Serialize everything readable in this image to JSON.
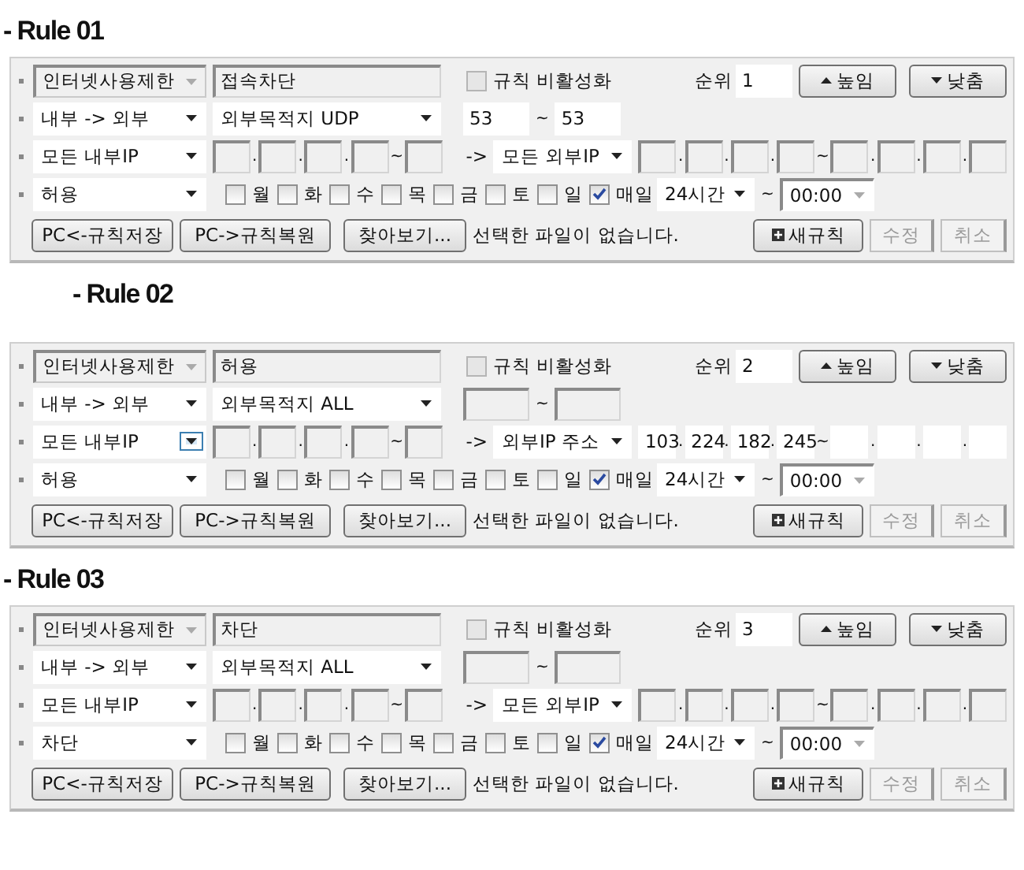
{
  "rules": [
    {
      "heading": "- Rule 01",
      "category": {
        "value": "인터넷사용제한",
        "disabled": true
      },
      "name": {
        "value": "접속차단",
        "disabled": true
      },
      "disable_rule": {
        "label": "규칙 비활성화",
        "checked": false,
        "disabled": true
      },
      "priority": {
        "label": "순위",
        "value": "1"
      },
      "raise_button": "높임",
      "lower_button": "낮춤",
      "direction": "내부 -> 외부",
      "destination": "외부목적지 UDP",
      "ports": [
        {
          "kind": "field",
          "value": "53",
          "disabled": false
        },
        {
          "kind": "sep",
          "text": "~"
        },
        {
          "kind": "field",
          "value": "53",
          "disabled": false
        }
      ],
      "source": {
        "value": "모든 내부IP",
        "focused": false
      },
      "source_ip": [
        {
          "kind": "field",
          "disabled": true
        },
        {
          "kind": "sep",
          "text": "."
        },
        {
          "kind": "field",
          "disabled": true
        },
        {
          "kind": "sep",
          "text": "."
        },
        {
          "kind": "field",
          "disabled": true
        },
        {
          "kind": "sep",
          "text": "."
        },
        {
          "kind": "field",
          "disabled": true
        },
        {
          "kind": "sep",
          "text": "~"
        },
        {
          "kind": "field",
          "disabled": true
        }
      ],
      "arrow": "->",
      "target": "모든 외부IP",
      "target_ip": [
        {
          "kind": "field",
          "disabled": true
        },
        {
          "kind": "sep",
          "text": "."
        },
        {
          "kind": "field",
          "disabled": true
        },
        {
          "kind": "sep",
          "text": "."
        },
        {
          "kind": "field",
          "disabled": true
        },
        {
          "kind": "sep",
          "text": "."
        },
        {
          "kind": "field",
          "disabled": true
        },
        {
          "kind": "sep",
          "text": "~"
        },
        {
          "kind": "field",
          "disabled": true
        },
        {
          "kind": "sep",
          "text": "."
        },
        {
          "kind": "field",
          "disabled": true
        },
        {
          "kind": "sep",
          "text": "."
        },
        {
          "kind": "field",
          "disabled": true
        },
        {
          "kind": "sep",
          "text": "."
        },
        {
          "kind": "field",
          "disabled": true
        }
      ],
      "action": "허용",
      "days": [
        {
          "label": "월",
          "checked": false
        },
        {
          "label": "화",
          "checked": false
        },
        {
          "label": "수",
          "checked": false
        },
        {
          "label": "목",
          "checked": false
        },
        {
          "label": "금",
          "checked": false
        },
        {
          "label": "토",
          "checked": false
        },
        {
          "label": "일",
          "checked": false
        }
      ],
      "daily": {
        "label": "매일",
        "checked": true
      },
      "duration": "24시간",
      "until_sep": "~",
      "until": {
        "value": "00:00",
        "disabled": true
      },
      "save_button": "PC<-규칙저장",
      "restore_button": "PC->규칙복원",
      "browse_button": "찾아보기...",
      "file_status": "선택한 파일이 없습니다.",
      "new_button": "새규칙",
      "edit_button": {
        "label": "수정",
        "disabled": true
      },
      "cancel_button": {
        "label": "취소",
        "disabled": true
      }
    },
    {
      "heading": "- Rule 02",
      "category": {
        "value": "인터넷사용제한",
        "disabled": true
      },
      "name": {
        "value": "허용",
        "disabled": true
      },
      "disable_rule": {
        "label": "규칙 비활성화",
        "checked": false,
        "disabled": true
      },
      "priority": {
        "label": "순위",
        "value": "2"
      },
      "raise_button": "높임",
      "lower_button": "낮춤",
      "direction": "내부 -> 외부",
      "destination": "외부목적지 ALL",
      "ports": [
        {
          "kind": "field",
          "disabled": true
        },
        {
          "kind": "sep",
          "text": "~"
        },
        {
          "kind": "field",
          "disabled": true
        }
      ],
      "source": {
        "value": "모든 내부IP",
        "focused": true
      },
      "source_ip": [
        {
          "kind": "field",
          "disabled": true
        },
        {
          "kind": "sep",
          "text": "."
        },
        {
          "kind": "field",
          "disabled": true
        },
        {
          "kind": "sep",
          "text": "."
        },
        {
          "kind": "field",
          "disabled": true
        },
        {
          "kind": "sep",
          "text": "."
        },
        {
          "kind": "field",
          "disabled": true
        },
        {
          "kind": "sep",
          "text": "~"
        },
        {
          "kind": "field",
          "disabled": true
        }
      ],
      "arrow": "->",
      "target": "외부IP 주소",
      "target_ip": [
        {
          "kind": "field",
          "value": "103",
          "disabled": false
        },
        {
          "kind": "sep",
          "text": "."
        },
        {
          "kind": "field",
          "value": "224",
          "disabled": false
        },
        {
          "kind": "sep",
          "text": "."
        },
        {
          "kind": "field",
          "value": "182",
          "disabled": false
        },
        {
          "kind": "sep",
          "text": "."
        },
        {
          "kind": "field",
          "value": "245",
          "disabled": false
        },
        {
          "kind": "sep",
          "text": "~"
        },
        {
          "kind": "field",
          "disabled": false
        },
        {
          "kind": "sep",
          "text": "."
        },
        {
          "kind": "field",
          "disabled": false
        },
        {
          "kind": "sep",
          "text": "."
        },
        {
          "kind": "field",
          "disabled": false
        },
        {
          "kind": "sep",
          "text": "."
        },
        {
          "kind": "field",
          "disabled": false
        }
      ],
      "action": "허용",
      "days": [
        {
          "label": "월",
          "checked": false
        },
        {
          "label": "화",
          "checked": false
        },
        {
          "label": "수",
          "checked": false
        },
        {
          "label": "목",
          "checked": false
        },
        {
          "label": "금",
          "checked": false
        },
        {
          "label": "토",
          "checked": false
        },
        {
          "label": "일",
          "checked": false
        }
      ],
      "daily": {
        "label": "매일",
        "checked": true
      },
      "duration": "24시간",
      "until_sep": "~",
      "until": {
        "value": "00:00",
        "disabled": true
      },
      "save_button": "PC<-규칙저장",
      "restore_button": "PC->규칙복원",
      "browse_button": "찾아보기...",
      "file_status": "선택한 파일이 없습니다.",
      "new_button": "새규칙",
      "edit_button": {
        "label": "수정",
        "disabled": true
      },
      "cancel_button": {
        "label": "취소",
        "disabled": true
      }
    },
    {
      "heading": "- Rule 03",
      "category": {
        "value": "인터넷사용제한",
        "disabled": true
      },
      "name": {
        "value": "차단",
        "disabled": true
      },
      "disable_rule": {
        "label": "규칙 비활성화",
        "checked": false,
        "disabled": true
      },
      "priority": {
        "label": "순위",
        "value": "3"
      },
      "raise_button": "높임",
      "lower_button": "낮춤",
      "direction": "내부 -> 외부",
      "destination": "외부목적지 ALL",
      "ports": [
        {
          "kind": "field",
          "disabled": true
        },
        {
          "kind": "sep",
          "text": "~"
        },
        {
          "kind": "field",
          "disabled": true
        }
      ],
      "source": {
        "value": "모든 내부IP",
        "focused": false
      },
      "source_ip": [
        {
          "kind": "field",
          "disabled": true
        },
        {
          "kind": "sep",
          "text": "."
        },
        {
          "kind": "field",
          "disabled": true
        },
        {
          "kind": "sep",
          "text": "."
        },
        {
          "kind": "field",
          "disabled": true
        },
        {
          "kind": "sep",
          "text": "."
        },
        {
          "kind": "field",
          "disabled": true
        },
        {
          "kind": "sep",
          "text": "~"
        },
        {
          "kind": "field",
          "disabled": true
        }
      ],
      "arrow": "->",
      "target": "모든 외부IP",
      "target_ip": [
        {
          "kind": "field",
          "disabled": true
        },
        {
          "kind": "sep",
          "text": "."
        },
        {
          "kind": "field",
          "disabled": true
        },
        {
          "kind": "sep",
          "text": "."
        },
        {
          "kind": "field",
          "disabled": true
        },
        {
          "kind": "sep",
          "text": "."
        },
        {
          "kind": "field",
          "disabled": true
        },
        {
          "kind": "sep",
          "text": "~"
        },
        {
          "kind": "field",
          "disabled": true
        },
        {
          "kind": "sep",
          "text": "."
        },
        {
          "kind": "field",
          "disabled": true
        },
        {
          "kind": "sep",
          "text": "."
        },
        {
          "kind": "field",
          "disabled": true
        },
        {
          "kind": "sep",
          "text": "."
        },
        {
          "kind": "field",
          "disabled": true
        }
      ],
      "action": "차단",
      "days": [
        {
          "label": "월",
          "checked": false
        },
        {
          "label": "화",
          "checked": false
        },
        {
          "label": "수",
          "checked": false
        },
        {
          "label": "목",
          "checked": false
        },
        {
          "label": "금",
          "checked": false
        },
        {
          "label": "토",
          "checked": false
        },
        {
          "label": "일",
          "checked": false
        }
      ],
      "daily": {
        "label": "매일",
        "checked": true
      },
      "duration": "24시간",
      "until_sep": "~",
      "until": {
        "value": "00:00",
        "disabled": true
      },
      "save_button": "PC<-규칙저장",
      "restore_button": "PC->규칙복원",
      "browse_button": "찾아보기...",
      "file_status": "선택한 파일이 없습니다.",
      "new_button": "새규칙",
      "edit_button": {
        "label": "수정",
        "disabled": true
      },
      "cancel_button": {
        "label": "취소",
        "disabled": true
      }
    }
  ]
}
